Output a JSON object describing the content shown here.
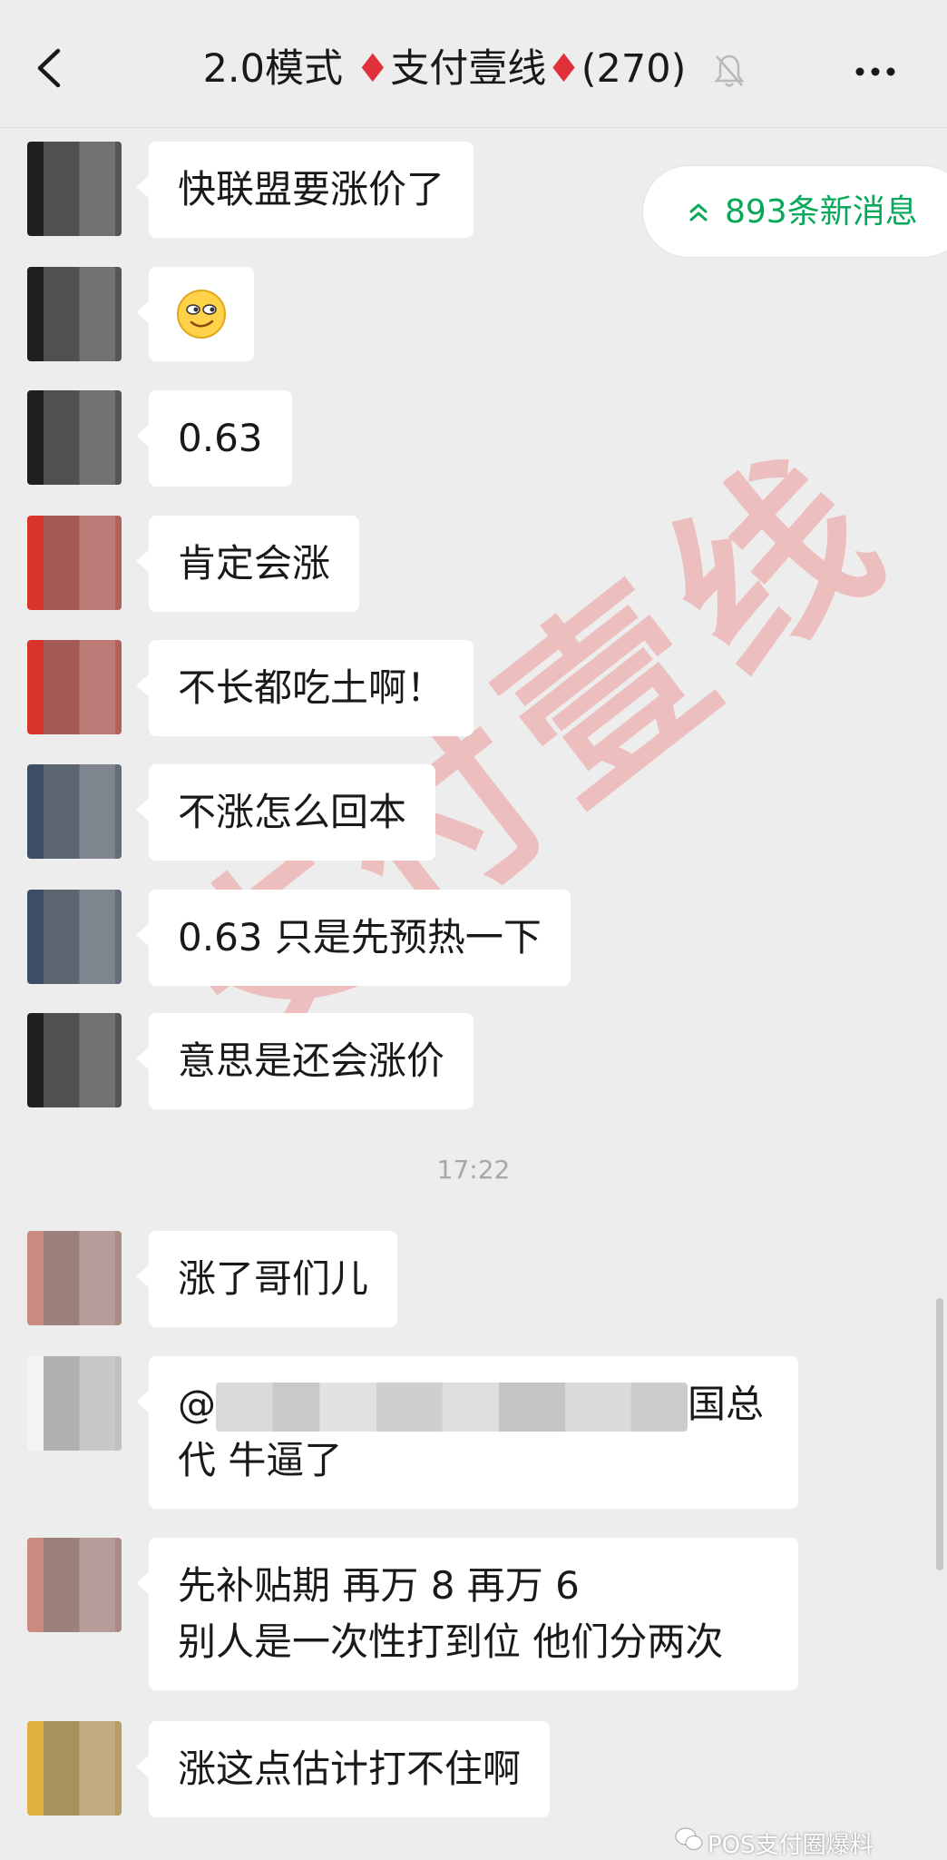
{
  "header": {
    "title_prefix": "2.0模式",
    "diamond": "♦",
    "title_middle": "支付壹线",
    "member_count": "(270)"
  },
  "new_messages": {
    "label": "893条新消息"
  },
  "messages": [
    {
      "text": "快联盟要涨价了"
    },
    {
      "emoji": "smirk-emoji"
    },
    {
      "text": "0.63"
    },
    {
      "text": "肯定会涨"
    },
    {
      "text": "不长都吃土啊！"
    },
    {
      "text": "不涨怎么回本"
    },
    {
      "text": "0.63 只是先预热一下"
    },
    {
      "text": "意思是还会涨价"
    },
    {
      "text": "涨了哥们儿"
    },
    {
      "line1_prefix": "@",
      "line1_suffix": "国总",
      "line2": "代  牛逼了"
    },
    {
      "line1": "先补贴期  再万 8  再万 6",
      "line2": "别人是一次性打到位  他们分两次"
    },
    {
      "text": "涨这点估计打不住啊"
    }
  ],
  "timestamp": "17:22",
  "watermark": "支付壹线",
  "footer": {
    "brand": "POS支付圈爆料"
  },
  "colors": {
    "accent_green": "#07a85a",
    "diamond_red": "#e0303a",
    "background": "#ededed"
  }
}
